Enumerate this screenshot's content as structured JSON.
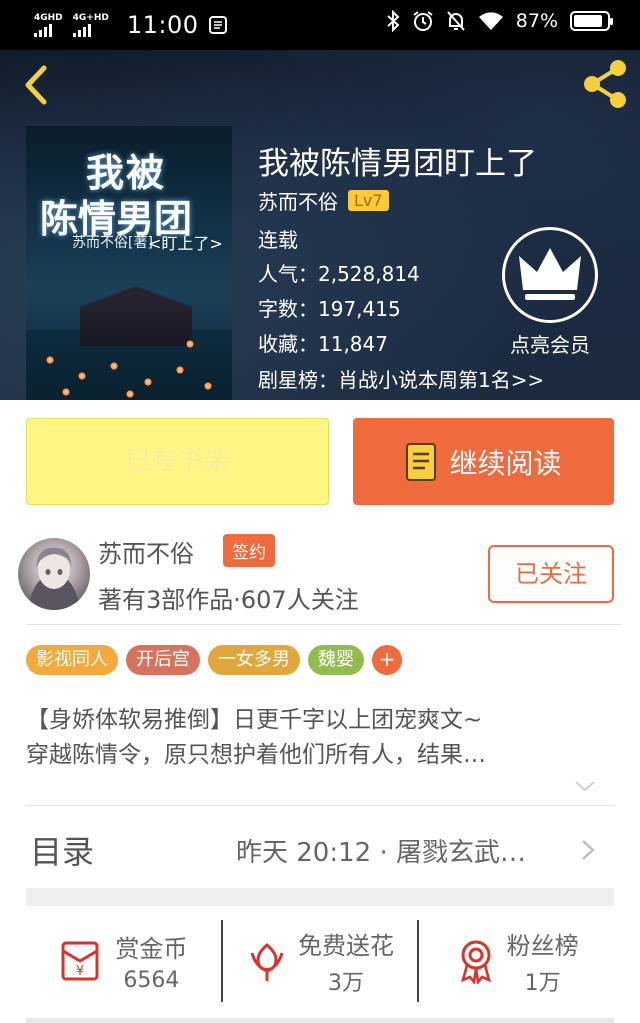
{
  "status_bar": {
    "sim1_label": "4GHD",
    "sim2_label": "4G+HD",
    "time": "11:00",
    "battery_text": "87%",
    "battery_level": 0.87
  },
  "book": {
    "title": "我被陈情男团盯上了",
    "author": "苏而不俗",
    "level": "Lv7",
    "status": "连载",
    "popularity": "人气：2,528,814",
    "word_count": "字数：197,415",
    "favorites": "收藏：11,847",
    "ranking": "剧星榜：肖战小说本周第1名>>",
    "vip_label": "点亮会员",
    "cover": {
      "title_line1": "我被",
      "title_line2": "陈情男团",
      "author_line": "苏而不俗[著]",
      "subtitle": "<盯上了>"
    }
  },
  "actions": {
    "shelf_label": "已在书架",
    "read_label": "继续阅读"
  },
  "author_card": {
    "name": "苏而不俗",
    "badge": "签约",
    "meta": "著有3部作品·607人关注",
    "follow_label": "已关注"
  },
  "tags": [
    {
      "label": "影视同人",
      "color": "#f3a93c"
    },
    {
      "label": "开后宫",
      "color": "#d5735e"
    },
    {
      "label": "一女多男",
      "color": "#e0a83b"
    },
    {
      "label": "魏婴",
      "color": "#93bc4f"
    }
  ],
  "tag_add": "+",
  "description": {
    "line1": "【身娇体软易推倒】日更千字以上团宠爽文~",
    "line2": "穿越陈情令，原只想护着他们所有人，结果…"
  },
  "toc": {
    "title": "目录",
    "latest": "昨天 20:12 · 屠戮玄武…"
  },
  "stats": [
    {
      "label": "赏金币",
      "value": "6564",
      "icon": "red-envelope-icon"
    },
    {
      "label": "免费送花",
      "value": "3万",
      "icon": "flower-icon"
    },
    {
      "label": "粉丝榜",
      "value": "1万",
      "icon": "medal-icon"
    }
  ],
  "colors": {
    "accent": "#ef6a3d",
    "shelf_bg": "#fff683",
    "hero_bg": "#17253a",
    "level_badge": "#ffc93a"
  }
}
